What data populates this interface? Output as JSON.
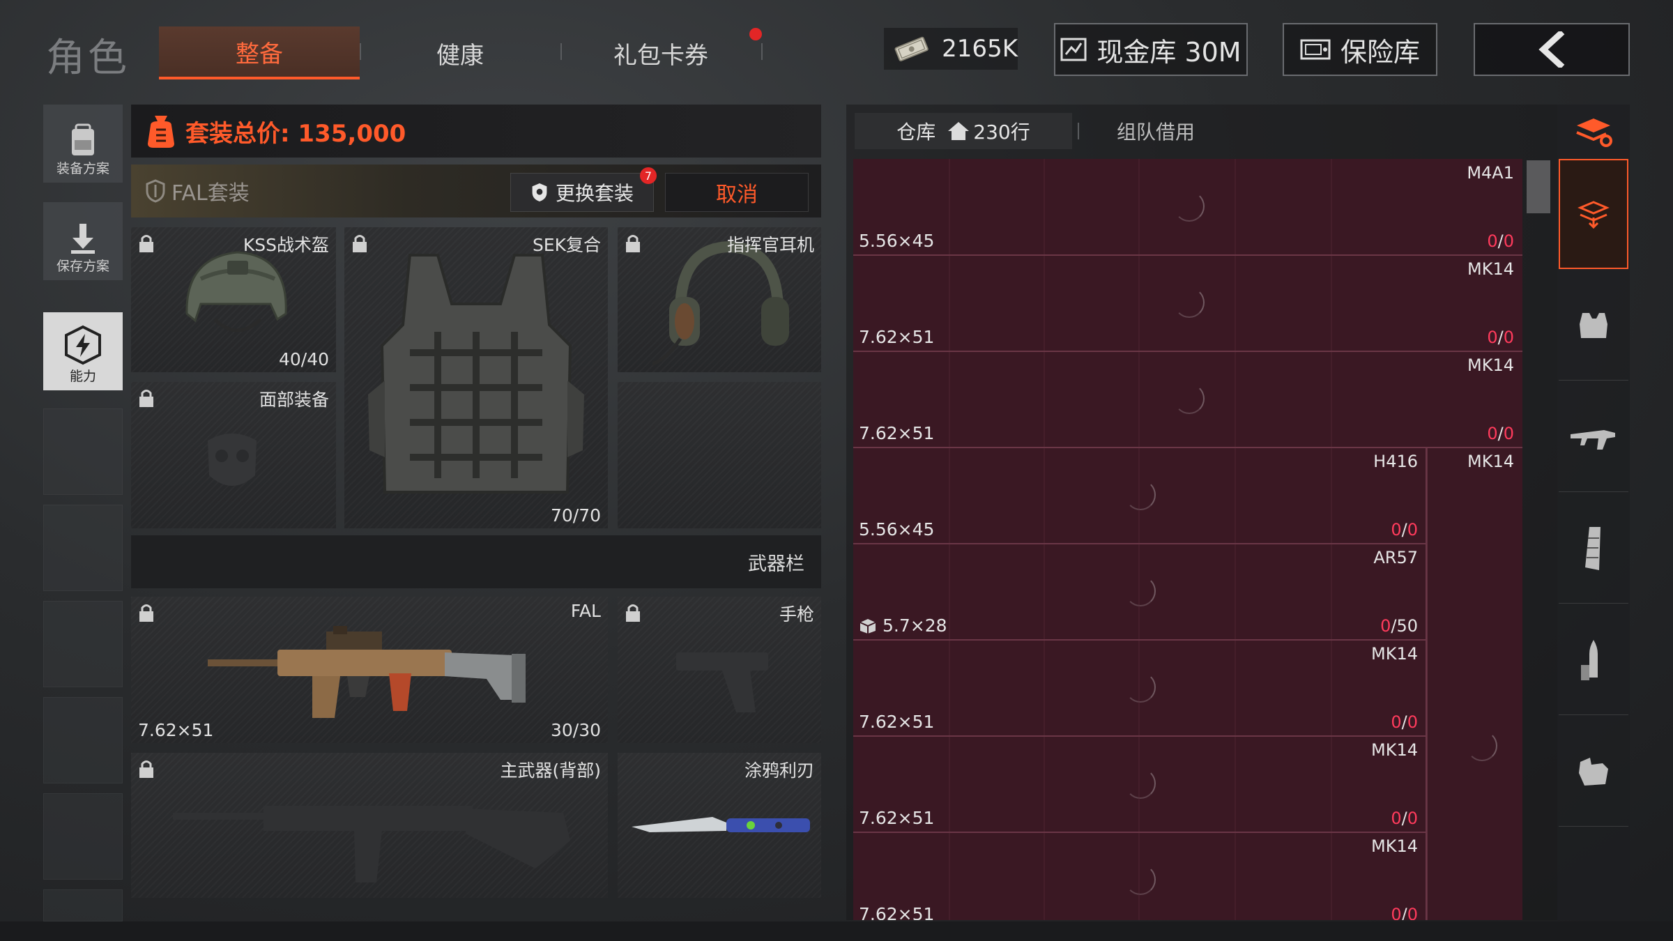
{
  "header": {
    "title": "角色",
    "tabs": [
      {
        "label": "整备",
        "active": true
      },
      {
        "label": "健康",
        "active": false
      },
      {
        "label": "礼包卡券",
        "active": false
      }
    ],
    "money": "2165K",
    "cash_vault": "现金库 30M",
    "safe": "保险库"
  },
  "rail": {
    "items": [
      {
        "label": "装备方案",
        "icon": "backpack-icon"
      },
      {
        "label": "保存方案",
        "icon": "download-icon"
      },
      {
        "label": "能力",
        "icon": "lightning-shield-icon",
        "active": true
      }
    ]
  },
  "loadout": {
    "total_label": "套装总价: 135,000",
    "preset_name": "FAL套装",
    "swap_label": "更换套装",
    "swap_badge": "7",
    "cancel_label": "取消",
    "slots": {
      "helmet": {
        "name": "KSS战术盔",
        "count": "40/40"
      },
      "armor": {
        "name": "SEK复合",
        "count": "70/70"
      },
      "headset": {
        "name": "指挥官耳机"
      },
      "face": {
        "name": "面部装备"
      }
    },
    "weapon_bar": "武器栏",
    "weapons": {
      "primary": {
        "name": "FAL",
        "caliber": "7.62×51",
        "ammo": "30/30"
      },
      "pistol": {
        "name": "手枪"
      },
      "back": {
        "name": "主武器(背部)"
      },
      "melee": {
        "name": "涂鸦利刃"
      }
    }
  },
  "warehouse": {
    "tab_storage": "仓库",
    "rows_label": "230行",
    "tab_team": "组队借用",
    "items": [
      {
        "caliber": "5.56×45",
        "weapon": "M4A1",
        "zero": "0",
        "total": "0"
      },
      {
        "caliber": "7.62×51",
        "weapon": "MK14",
        "zero": "0",
        "total": "0"
      },
      {
        "caliber": "7.62×51",
        "weapon": "MK14",
        "zero": "0",
        "total": "0"
      },
      {
        "caliber": "5.56×45",
        "weapon": "H416",
        "zero": "0",
        "total": "0",
        "side_weapon": "MK14"
      },
      {
        "caliber": "5.7×28",
        "weapon": "AR57",
        "zero": "0",
        "total": "50",
        "boxed": true
      },
      {
        "caliber": "7.62×51",
        "weapon": "MK14",
        "zero": "0",
        "total": "0"
      },
      {
        "caliber": "7.62×51",
        "weapon": "MK14",
        "zero": "0",
        "total": "0"
      },
      {
        "caliber": "7.62×51",
        "weapon": "MK14",
        "zero": "0",
        "total": "0"
      }
    ]
  },
  "filters": [
    "all-items-icon",
    "equipment-icon",
    "armor-icon",
    "rifle-icon",
    "magazine-icon",
    "ammo-icon",
    "gear-vest-icon"
  ],
  "colors": {
    "accent": "#ff5a2a",
    "warehouse_bg": "#3a1823",
    "zero_red": "#ff3b5c"
  }
}
